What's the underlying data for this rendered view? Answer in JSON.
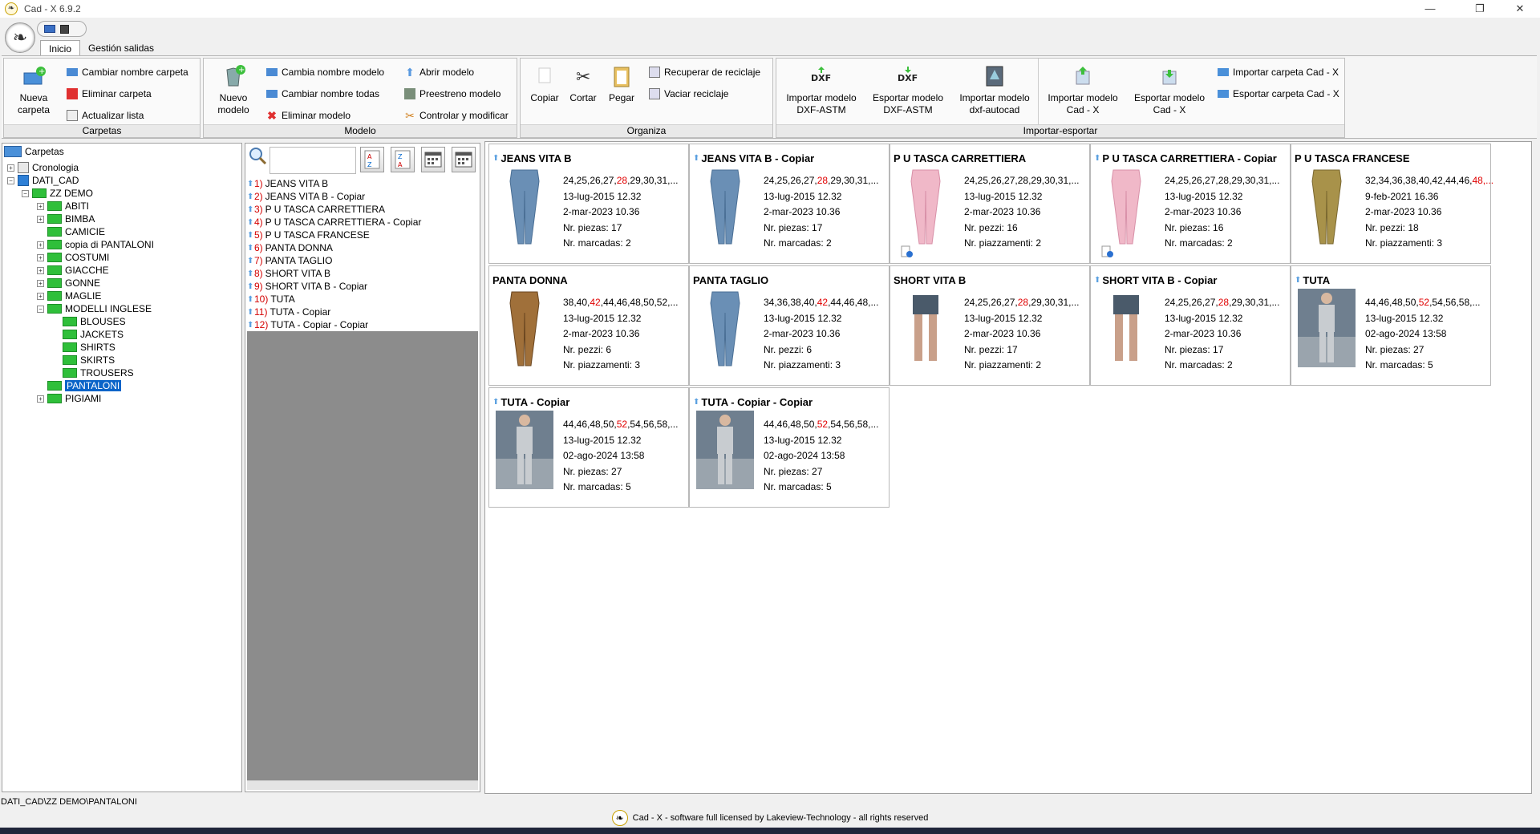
{
  "window": {
    "title": "Cad - X 6.9.2",
    "logo_glyph": "❧",
    "minimize": "—",
    "maximize": "❐",
    "close": "✕"
  },
  "ribbon_tabs": [
    "Inicio",
    "Gestión salidas"
  ],
  "ribbon": {
    "carpetas": {
      "label": "Carpetas",
      "nueva_carpeta": [
        "Nueva",
        "carpeta"
      ],
      "cambiar_nombre": "Cambiar nombre carpeta",
      "eliminar": "Eliminar carpeta",
      "actualizar": "Actualizar lista"
    },
    "modelo": {
      "label": "Modelo",
      "nuevo_modelo": [
        "Nuevo",
        "modelo"
      ],
      "cambia_nombre": "Cambia nombre modelo",
      "cambiar_todas": "Cambiar nombre todas",
      "eliminar": "Eliminar modelo",
      "abrir": "Abrir modelo",
      "preestreno": "Preestreno modelo",
      "controlar": "Controlar y modificar"
    },
    "organiza": {
      "label": "Organiza",
      "copiar": "Copiar",
      "cortar": "Cortar",
      "pegar": "Pegar",
      "recuperar": "Recuperar de reciclaje",
      "vaciar": "Vaciar reciclaje"
    },
    "importar": {
      "label": "Importar-esportar",
      "imp_dxf": [
        "Importar modelo",
        "DXF-ASTM"
      ],
      "exp_dxf": [
        "Esportar modelo",
        "DXF-ASTM"
      ],
      "imp_autocad": [
        "Importar modelo",
        "dxf-autocad"
      ],
      "imp_cadx": [
        "Importar modelo",
        "Cad - X"
      ],
      "exp_cadx": [
        "Esportar modelo",
        "Cad - X"
      ],
      "imp_carpeta": "Importar carpeta Cad - X",
      "exp_carpeta": "Esportar carpeta Cad - X",
      "dxf_text": "DXF"
    }
  },
  "tree": {
    "root": "Carpetas",
    "cronologia": "Cronologia",
    "dati_cad": "DATI_CAD",
    "zz_demo": "ZZ DEMO",
    "children": [
      "ABITI",
      "BIMBA",
      "CAMICIE",
      "copia di PANTALONI",
      "COSTUMI",
      "GIACCHE",
      "GONNE",
      "MAGLIE"
    ],
    "modelli": "MODELLI INGLESE",
    "modelli_children": [
      "BLOUSES",
      "JACKETS",
      "SHIRTS",
      "SKIRTS",
      "TROUSERS"
    ],
    "pantaloni": "PANTALONI",
    "pigiami": "PIGIAMI"
  },
  "list": {
    "sort_a": "A↓Z",
    "sort_z": "Z↓A",
    "items": [
      {
        "n": "1)",
        "t": "JEANS VITA B"
      },
      {
        "n": "2)",
        "t": "JEANS VITA B - Copiar"
      },
      {
        "n": "3)",
        "t": "P U TASCA CARRETTIERA"
      },
      {
        "n": "4)",
        "t": "P U TASCA CARRETTIERA - Copiar"
      },
      {
        "n": "5)",
        "t": "P U TASCA FRANCESE"
      },
      {
        "n": "6)",
        "t": "PANTA DONNA"
      },
      {
        "n": "7)",
        "t": "PANTA TAGLIO"
      },
      {
        "n": "8)",
        "t": "SHORT VITA B"
      },
      {
        "n": "9)",
        "t": "SHORT VITA B - Copiar"
      },
      {
        "n": "10)",
        "t": "TUTA"
      },
      {
        "n": "11)",
        "t": "TUTA - Copiar"
      },
      {
        "n": "12)",
        "t": "TUTA - Copiar - Copiar"
      }
    ]
  },
  "cards": [
    {
      "title": "JEANS VITA B",
      "s1": "24,25,26,27,",
      "s2": "28",
      "s3": ",29,30,31,...",
      "d1": "13-lug-2015 12.32",
      "d2": "2-mar-2023 10.36",
      "l4": "Nr. piezas: 17",
      "l5": "Nr. marcadas: 2",
      "thumb": "jeans",
      "arrow": true
    },
    {
      "title": "JEANS VITA B - Copiar",
      "s1": "24,25,26,27,",
      "s2": "28",
      "s3": ",29,30,31,...",
      "d1": "13-lug-2015 12.32",
      "d2": "2-mar-2023 10.36",
      "l4": "Nr. piezas: 17",
      "l5": "Nr. marcadas: 2",
      "thumb": "jeans",
      "arrow": true
    },
    {
      "title": "P U TASCA CARRETTIERA",
      "s1": "24,25,26,27,28,29,30,31,...",
      "s2": "",
      "s3": "",
      "d1": "13-lug-2015 12.32",
      "d2": "2-mar-2023 10.36",
      "l4": "Nr. pezzi: 16",
      "l5": "Nr. piazzamenti: 2",
      "thumb": "pink",
      "arrow": false
    },
    {
      "title": "P U TASCA CARRETTIERA - Copiar",
      "s1": "24,25,26,27,28,29,30,31,...",
      "s2": "",
      "s3": "",
      "d1": "13-lug-2015 12.32",
      "d2": "2-mar-2023 10.36",
      "l4": "Nr. piezas: 16",
      "l5": "Nr. marcadas: 2",
      "thumb": "pink",
      "arrow": true
    },
    {
      "title": "P U TASCA FRANCESE",
      "s1": "32,34,36,38,40,42,44,46,",
      "s2": "48,...",
      "s3": "",
      "d1": "9-feb-2021 16.36",
      "d2": "2-mar-2023 10.36",
      "l4": "Nr. pezzi: 18",
      "l5": "Nr. piazzamenti: 3",
      "thumb": "khaki",
      "arrow": false
    },
    {
      "title": "PANTA DONNA",
      "s1": "38,40,",
      "s2": "42",
      "s3": ",44,46,48,50,52,...",
      "d1": "13-lug-2015 12.32",
      "d2": "2-mar-2023 10.36",
      "l4": "Nr. pezzi: 6",
      "l5": "Nr. piazzamenti: 3",
      "thumb": "brown",
      "arrow": false
    },
    {
      "title": "PANTA TAGLIO",
      "s1": "34,36,38,40,",
      "s2": "42",
      "s3": ",44,46,48,...",
      "d1": "13-lug-2015 12.32",
      "d2": "2-mar-2023 10.36",
      "l4": "Nr. pezzi: 6",
      "l5": "Nr. piazzamenti: 3",
      "thumb": "jeans",
      "arrow": false
    },
    {
      "title": "SHORT VITA B",
      "s1": "24,25,26,27,",
      "s2": "28",
      "s3": ",29,30,31,...",
      "d1": "13-lug-2015 12.32",
      "d2": "2-mar-2023 10.36",
      "l4": "Nr. pezzi: 17",
      "l5": "Nr. piazzamenti: 2",
      "thumb": "short",
      "arrow": false
    },
    {
      "title": "SHORT VITA B - Copiar",
      "s1": "24,25,26,27,",
      "s2": "28",
      "s3": ",29,30,31,...",
      "d1": "13-lug-2015 12.32",
      "d2": "2-mar-2023 10.36",
      "l4": "Nr. piezas: 17",
      "l5": "Nr. marcadas: 2",
      "thumb": "short",
      "arrow": true
    },
    {
      "title": "TUTA",
      "s1": "44,46,48,50,",
      "s2": "52",
      "s3": ",54,56,58,...",
      "d1": "13-lug-2015 12.32",
      "d2": "02-ago-2024 13:58",
      "l4": "Nr. piezas: 27",
      "l5": "Nr. marcadas: 5",
      "thumb": "tuta",
      "arrow": true
    },
    {
      "title": "TUTA - Copiar",
      "s1": "44,46,48,50,",
      "s2": "52",
      "s3": ",54,56,58,...",
      "d1": "13-lug-2015 12.32",
      "d2": "02-ago-2024 13:58",
      "l4": "Nr. piezas: 27",
      "l5": "Nr. marcadas: 5",
      "thumb": "tuta",
      "arrow": true
    },
    {
      "title": "TUTA - Copiar - Copiar",
      "s1": "44,46,48,50,",
      "s2": "52",
      "s3": ",54,56,58,...",
      "d1": "13-lug-2015 12.32",
      "d2": "02-ago-2024 13:58",
      "l4": "Nr. piezas: 27",
      "l5": "Nr. marcadas: 5",
      "thumb": "tuta",
      "arrow": true
    }
  ],
  "status": {
    "path": "DATI_CAD\\ZZ DEMO\\PANTALONI",
    "footer": "Cad - X - software full licensed by Lakeview-Technology - all rights reserved"
  }
}
